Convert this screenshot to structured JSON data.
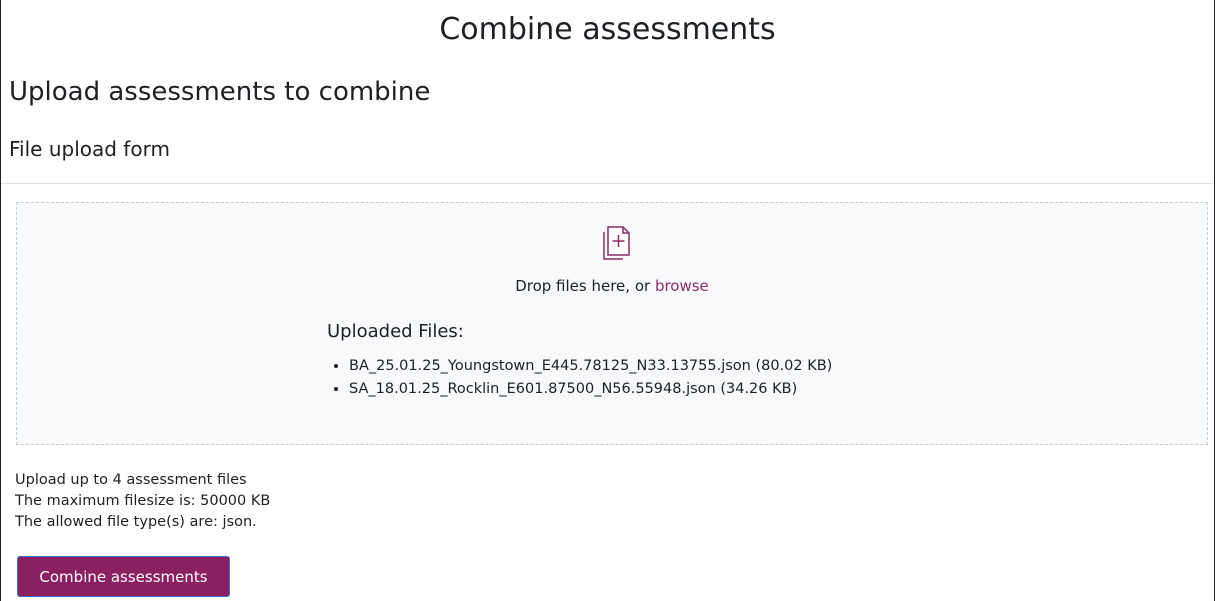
{
  "page": {
    "title": "Combine assessments",
    "section_heading": "Upload assessments to combine",
    "form_heading": "File upload form"
  },
  "dropzone": {
    "icon": "file-add-icon",
    "drop_text": "Drop files here, or ",
    "browse_label": "browse",
    "uploaded_title": "Uploaded Files:",
    "files": [
      {
        "label": "BA_25.01.25_Youngstown_E445.78125_N33.13755.json (80.02 KB)"
      },
      {
        "label": "SA_18.01.25_Rocklin_E601.87500_N56.55948.json (34.26 KB)"
      }
    ]
  },
  "info": {
    "max_files": "Upload up to 4 assessment files",
    "max_size": "The maximum filesize is: 50000 KB",
    "file_types": "The allowed file type(s) are: json."
  },
  "actions": {
    "combine_label": "Combine assessments"
  },
  "colors": {
    "accent": "#8b2060",
    "link": "#8b2d67"
  }
}
